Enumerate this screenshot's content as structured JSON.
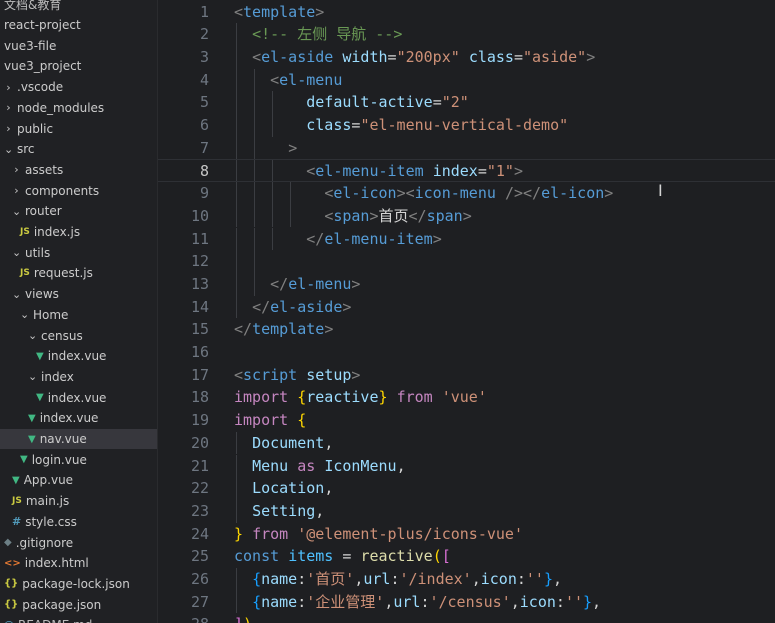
{
  "explorer": {
    "items": [
      {
        "label": "文档&教育",
        "twisty": "",
        "icon": "",
        "indent": 0,
        "partial": true
      },
      {
        "label": "react-project",
        "twisty": "",
        "icon": "",
        "indent": 0
      },
      {
        "label": "vue3-file",
        "twisty": "",
        "icon": "",
        "indent": 0
      },
      {
        "label": "vue3_project",
        "twisty": "",
        "icon": "",
        "indent": 0
      },
      {
        "label": ".vscode",
        "twisty": "›",
        "icon": "",
        "indent": 0
      },
      {
        "label": "node_modules",
        "twisty": "›",
        "icon": "",
        "indent": 0
      },
      {
        "label": "public",
        "twisty": "›",
        "icon": "",
        "indent": 0
      },
      {
        "label": "src",
        "twisty": "⌄",
        "icon": "",
        "indent": 0
      },
      {
        "label": "assets",
        "twisty": "›",
        "icon": "",
        "indent": 1
      },
      {
        "label": "components",
        "twisty": "›",
        "icon": "",
        "indent": 1
      },
      {
        "label": "router",
        "twisty": "⌄",
        "icon": "",
        "indent": 1
      },
      {
        "label": "index.js",
        "twisty": "",
        "icon": "js",
        "indent": 2
      },
      {
        "label": "utils",
        "twisty": "⌄",
        "icon": "",
        "indent": 1
      },
      {
        "label": "request.js",
        "twisty": "",
        "icon": "js",
        "indent": 2
      },
      {
        "label": "views",
        "twisty": "⌄",
        "icon": "",
        "indent": 1
      },
      {
        "label": "Home",
        "twisty": "⌄",
        "icon": "",
        "indent": 2
      },
      {
        "label": "census",
        "twisty": "⌄",
        "icon": "",
        "indent": 3
      },
      {
        "label": "index.vue",
        "twisty": "",
        "icon": "vue",
        "indent": 4
      },
      {
        "label": "index",
        "twisty": "⌄",
        "icon": "",
        "indent": 3
      },
      {
        "label": "index.vue",
        "twisty": "",
        "icon": "vue",
        "indent": 4
      },
      {
        "label": "index.vue",
        "twisty": "",
        "icon": "vue",
        "indent": 3
      },
      {
        "label": "nav.vue",
        "twisty": "",
        "icon": "vue",
        "indent": 3,
        "selected": true
      },
      {
        "label": "login.vue",
        "twisty": "",
        "icon": "vue",
        "indent": 2
      },
      {
        "label": "App.vue",
        "twisty": "",
        "icon": "vue",
        "indent": 1
      },
      {
        "label": "main.js",
        "twisty": "",
        "icon": "js",
        "indent": 1
      },
      {
        "label": "style.css",
        "twisty": "",
        "icon": "css",
        "indent": 1
      },
      {
        "label": ".gitignore",
        "twisty": "",
        "icon": "git",
        "indent": 0
      },
      {
        "label": "index.html",
        "twisty": "",
        "icon": "html",
        "indent": 0
      },
      {
        "label": "package-lock.json",
        "twisty": "",
        "icon": "json",
        "indent": 0
      },
      {
        "label": "package.json",
        "twisty": "",
        "icon": "json",
        "indent": 0
      },
      {
        "label": "README.md",
        "twisty": "",
        "icon": "md",
        "indent": 0,
        "partial": true
      }
    ],
    "icon_glyphs": {
      "js": "JS",
      "vue": "▼",
      "css": "#",
      "html": "<>",
      "json": "{}",
      "git": "◆",
      "md": "ⓘ"
    }
  },
  "editor": {
    "active_line": 8,
    "lines": [
      {
        "n": "1",
        "guides": [],
        "tokens": [
          [
            "t-bracket",
            "<"
          ],
          [
            "t-tag",
            "template"
          ],
          [
            "t-bracket",
            ">"
          ]
        ]
      },
      {
        "n": "2",
        "guides": [
          0
        ],
        "tokens": [
          [
            "t-text",
            "  "
          ],
          [
            "t-comment",
            "<!-- 左侧 导航 -->"
          ]
        ]
      },
      {
        "n": "3",
        "guides": [
          0
        ],
        "tokens": [
          [
            "t-text",
            "  "
          ],
          [
            "t-bracket",
            "<"
          ],
          [
            "t-tag",
            "el-aside"
          ],
          [
            "t-text",
            " "
          ],
          [
            "t-attr",
            "width"
          ],
          [
            "t-punct",
            "="
          ],
          [
            "t-str",
            "\"200px\""
          ],
          [
            "t-text",
            " "
          ],
          [
            "t-attr",
            "class"
          ],
          [
            "t-punct",
            "="
          ],
          [
            "t-str",
            "\"aside\""
          ],
          [
            "t-bracket",
            ">"
          ]
        ]
      },
      {
        "n": "4",
        "guides": [
          0,
          1
        ],
        "tokens": [
          [
            "t-text",
            "    "
          ],
          [
            "t-bracket",
            "<"
          ],
          [
            "t-tag",
            "el-menu"
          ]
        ]
      },
      {
        "n": "5",
        "guides": [
          0,
          1,
          2
        ],
        "tokens": [
          [
            "t-text",
            "        "
          ],
          [
            "t-attr",
            "default-active"
          ],
          [
            "t-punct",
            "="
          ],
          [
            "t-str",
            "\"2\""
          ]
        ]
      },
      {
        "n": "6",
        "guides": [
          0,
          1,
          2
        ],
        "tokens": [
          [
            "t-text",
            "        "
          ],
          [
            "t-attr",
            "class"
          ],
          [
            "t-punct",
            "="
          ],
          [
            "t-str",
            "\"el-menu-vertical-demo\""
          ]
        ]
      },
      {
        "n": "7",
        "guides": [
          0,
          1
        ],
        "tokens": [
          [
            "t-text",
            "      "
          ],
          [
            "t-bracket",
            ">"
          ]
        ]
      },
      {
        "n": "8",
        "guides": [
          0,
          1,
          2
        ],
        "tokens": [
          [
            "t-text",
            "        "
          ],
          [
            "t-bracket",
            "<"
          ],
          [
            "t-tag",
            "el-menu-item"
          ],
          [
            "t-text",
            " "
          ],
          [
            "t-attr",
            "index"
          ],
          [
            "t-punct",
            "="
          ],
          [
            "t-str",
            "\"1\""
          ],
          [
            "t-bracket",
            ">"
          ]
        ]
      },
      {
        "n": "9",
        "guides": [
          0,
          1,
          2,
          3
        ],
        "tokens": [
          [
            "t-text",
            "          "
          ],
          [
            "t-bracket",
            "<"
          ],
          [
            "t-tag",
            "el-icon"
          ],
          [
            "t-bracket",
            "><"
          ],
          [
            "t-tag",
            "icon-menu"
          ],
          [
            "t-text",
            " "
          ],
          [
            "t-bracket",
            "/></"
          ],
          [
            "t-tag",
            "el-icon"
          ],
          [
            "t-bracket",
            ">"
          ]
        ]
      },
      {
        "n": "10",
        "guides": [
          0,
          1,
          2,
          3
        ],
        "tokens": [
          [
            "t-text",
            "          "
          ],
          [
            "t-bracket",
            "<"
          ],
          [
            "t-tag",
            "span"
          ],
          [
            "t-bracket",
            ">"
          ],
          [
            "t-text",
            "首页"
          ],
          [
            "t-bracket",
            "</"
          ],
          [
            "t-tag",
            "span"
          ],
          [
            "t-bracket",
            ">"
          ]
        ]
      },
      {
        "n": "11",
        "guides": [
          0,
          1,
          2
        ],
        "tokens": [
          [
            "t-text",
            "        "
          ],
          [
            "t-bracket",
            "</"
          ],
          [
            "t-tag",
            "el-menu-item"
          ],
          [
            "t-bracket",
            ">"
          ]
        ]
      },
      {
        "n": "12",
        "guides": [
          0,
          1
        ],
        "tokens": []
      },
      {
        "n": "13",
        "guides": [
          0,
          1
        ],
        "tokens": [
          [
            "t-text",
            "    "
          ],
          [
            "t-bracket",
            "</"
          ],
          [
            "t-tag",
            "el-menu"
          ],
          [
            "t-bracket",
            ">"
          ]
        ]
      },
      {
        "n": "14",
        "guides": [
          0
        ],
        "tokens": [
          [
            "t-text",
            "  "
          ],
          [
            "t-bracket",
            "</"
          ],
          [
            "t-tag",
            "el-aside"
          ],
          [
            "t-bracket",
            ">"
          ]
        ]
      },
      {
        "n": "15",
        "guides": [],
        "tokens": [
          [
            "t-bracket",
            "</"
          ],
          [
            "t-tag",
            "template"
          ],
          [
            "t-bracket",
            ">"
          ]
        ]
      },
      {
        "n": "16",
        "guides": [],
        "tokens": []
      },
      {
        "n": "17",
        "guides": [],
        "tokens": [
          [
            "t-bracket",
            "<"
          ],
          [
            "t-tag",
            "script"
          ],
          [
            "t-text",
            " "
          ],
          [
            "t-attr",
            "setup"
          ],
          [
            "t-bracket",
            ">"
          ]
        ]
      },
      {
        "n": "18",
        "guides": [],
        "tokens": [
          [
            "t-kw",
            "import"
          ],
          [
            "t-text",
            " "
          ],
          [
            "t-brace2",
            "{"
          ],
          [
            "t-var",
            "reactive"
          ],
          [
            "t-brace2",
            "}"
          ],
          [
            "t-text",
            " "
          ],
          [
            "t-kw",
            "from"
          ],
          [
            "t-text",
            " "
          ],
          [
            "t-str",
            "'vue'"
          ]
        ]
      },
      {
        "n": "19",
        "guides": [],
        "tokens": [
          [
            "t-kw",
            "import"
          ],
          [
            "t-text",
            " "
          ],
          [
            "t-brace2",
            "{"
          ]
        ]
      },
      {
        "n": "20",
        "guides": [
          0
        ],
        "tokens": [
          [
            "t-text",
            "  "
          ],
          [
            "t-var",
            "Document"
          ],
          [
            "t-punct",
            ","
          ]
        ]
      },
      {
        "n": "21",
        "guides": [
          0
        ],
        "tokens": [
          [
            "t-text",
            "  "
          ],
          [
            "t-var",
            "Menu"
          ],
          [
            "t-text",
            " "
          ],
          [
            "t-kw",
            "as"
          ],
          [
            "t-text",
            " "
          ],
          [
            "t-var",
            "IconMenu"
          ],
          [
            "t-punct",
            ","
          ]
        ]
      },
      {
        "n": "22",
        "guides": [
          0
        ],
        "tokens": [
          [
            "t-text",
            "  "
          ],
          [
            "t-var",
            "Location"
          ],
          [
            "t-punct",
            ","
          ]
        ]
      },
      {
        "n": "23",
        "guides": [
          0
        ],
        "tokens": [
          [
            "t-text",
            "  "
          ],
          [
            "t-var",
            "Setting"
          ],
          [
            "t-punct",
            ","
          ]
        ]
      },
      {
        "n": "24",
        "guides": [],
        "tokens": [
          [
            "t-brace2",
            "}"
          ],
          [
            "t-text",
            " "
          ],
          [
            "t-kw",
            "from"
          ],
          [
            "t-text",
            " "
          ],
          [
            "t-str",
            "'@element-plus/icons-vue'"
          ]
        ]
      },
      {
        "n": "25",
        "guides": [],
        "tokens": [
          [
            "t-kw2",
            "const"
          ],
          [
            "t-text",
            " "
          ],
          [
            "t-const",
            "items"
          ],
          [
            "t-text",
            " "
          ],
          [
            "t-punct",
            "="
          ],
          [
            "t-text",
            " "
          ],
          [
            "t-func",
            "reactive"
          ],
          [
            "t-brace2",
            "("
          ],
          [
            "t-brace",
            "["
          ]
        ]
      },
      {
        "n": "26",
        "guides": [
          0
        ],
        "tokens": [
          [
            "t-text",
            "  "
          ],
          [
            "t-brace3",
            "{"
          ],
          [
            "t-var",
            "name"
          ],
          [
            "t-punct",
            ":"
          ],
          [
            "t-str",
            "'首页'"
          ],
          [
            "t-punct",
            ","
          ],
          [
            "t-var",
            "url"
          ],
          [
            "t-punct",
            ":"
          ],
          [
            "t-str",
            "'/index'"
          ],
          [
            "t-punct",
            ","
          ],
          [
            "t-var",
            "icon"
          ],
          [
            "t-punct",
            ":"
          ],
          [
            "t-str",
            "''"
          ],
          [
            "t-brace3",
            "}"
          ],
          [
            "t-punct",
            ","
          ]
        ]
      },
      {
        "n": "27",
        "guides": [
          0
        ],
        "tokens": [
          [
            "t-text",
            "  "
          ],
          [
            "t-brace3",
            "{"
          ],
          [
            "t-var",
            "name"
          ],
          [
            "t-punct",
            ":"
          ],
          [
            "t-str",
            "'企业管理'"
          ],
          [
            "t-punct",
            ","
          ],
          [
            "t-var",
            "url"
          ],
          [
            "t-punct",
            ":"
          ],
          [
            "t-str",
            "'/census'"
          ],
          [
            "t-punct",
            ","
          ],
          [
            "t-var",
            "icon"
          ],
          [
            "t-punct",
            ":"
          ],
          [
            "t-str",
            "''"
          ],
          [
            "t-brace3",
            "}"
          ],
          [
            "t-punct",
            ","
          ]
        ]
      },
      {
        "n": "28",
        "guides": [],
        "tokens": [
          [
            "t-brace",
            "]"
          ],
          [
            "t-brace2",
            ")"
          ]
        ]
      }
    ],
    "cursor_glyph": "I"
  }
}
